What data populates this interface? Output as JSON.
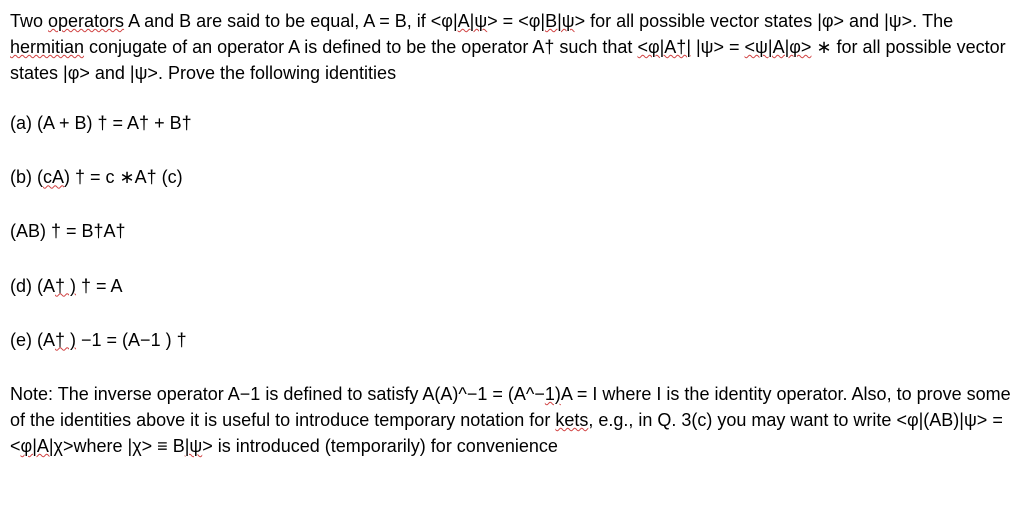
{
  "intro": {
    "part1": "Two ",
    "operators": "operators",
    "part2": " A and B are said to be equal, A = B, if <φ|",
    "Alw1": "A|ψ",
    "part3": "> = <φ|",
    "Blw1": "B|ψ",
    "part4": "> for all possible vector states |φ> and |ψ>. The ",
    "hermitian": "hermitian",
    "part5": " conjugate of an operator A is defined to be the operator A† such that ",
    "phiAdag": "<φ|A†|",
    "part6": " |ψ> = ",
    "psiAphi": "<ψ|A|φ>",
    "part7": " ∗ for all possible vector states |φ> and |ψ>. Prove the following identities"
  },
  "items": {
    "a": "(a) (A + B) † = A† + B†",
    "b_pre": "(b) (",
    "b_cA": "cA",
    "b_post": ") † = c ∗A† (c)",
    "c": "(AB) † = B†A†",
    "d_pre": "(d) (A",
    "d_dag": "† )",
    "d_post": " † = A",
    "e_pre": "(e) (A",
    "e_dag": "† )",
    "e_post": " −1 = (A−1 ) †"
  },
  "note": {
    "part1": "Note: The inverse operator A−1 is defined to satisfy A(A)^−1 = (A^−",
    "one": "1)",
    "part2": "A = I where I is the identity operator. Also, to prove some of the identities above it is useful to introduce temporary notation for ",
    "kets": "kets",
    "part3": ", e.g., in Q. 3(c) you may want to write <φ|(AB)|ψ> = <",
    "phiAchi": "φ|A|χ",
    "part4": ">where |",
    "chi": "χ",
    "part5": "> ≡ B",
    "lpsi": "|ψ",
    "part6": "> is introduced (temporarily) for convenience"
  }
}
